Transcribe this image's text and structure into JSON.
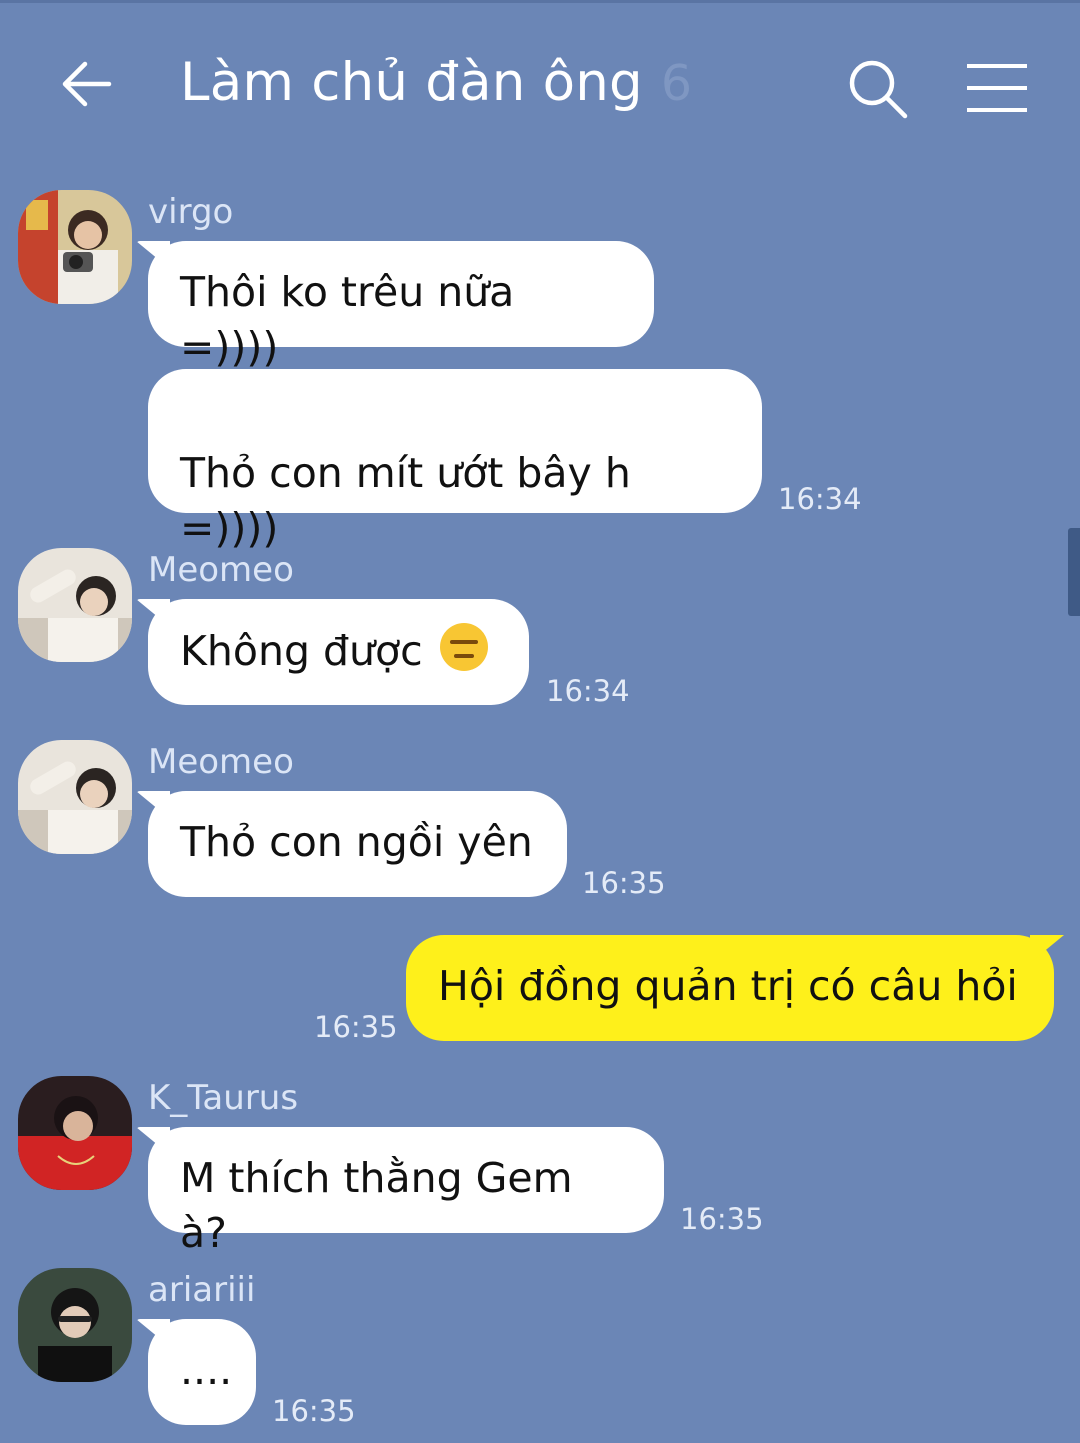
{
  "header": {
    "back_icon": "arrow-left-icon",
    "title": "Làm chủ đàn ông",
    "member_count": "6",
    "search_icon": "search-icon",
    "menu_icon": "hamburger-menu-icon"
  },
  "colors": {
    "background": "#6b86b6",
    "incoming_bubble": "#ffffff",
    "outgoing_bubble": "#fef01b"
  },
  "messages": [
    {
      "sender": "virgo",
      "lines": [
        "Thôi ko trêu nữa =))))",
        "Thỏ con mít ướt bây h\n=))))"
      ],
      "time": "16:34"
    },
    {
      "sender": "Meomeo",
      "text": "Không được",
      "emoji": "expressionless-face-emoji",
      "time": "16:34"
    },
    {
      "sender": "Meomeo",
      "text": "Thỏ con ngồi yên",
      "time": "16:35"
    },
    {
      "sender": "me",
      "text": "Hội đồng quản trị có câu hỏi",
      "time": "16:35"
    },
    {
      "sender": "K_Taurus",
      "text": "M thích thằng Gem à?",
      "time": "16:35"
    },
    {
      "sender": "ariariii",
      "text": "....",
      "time": "16:35"
    }
  ]
}
